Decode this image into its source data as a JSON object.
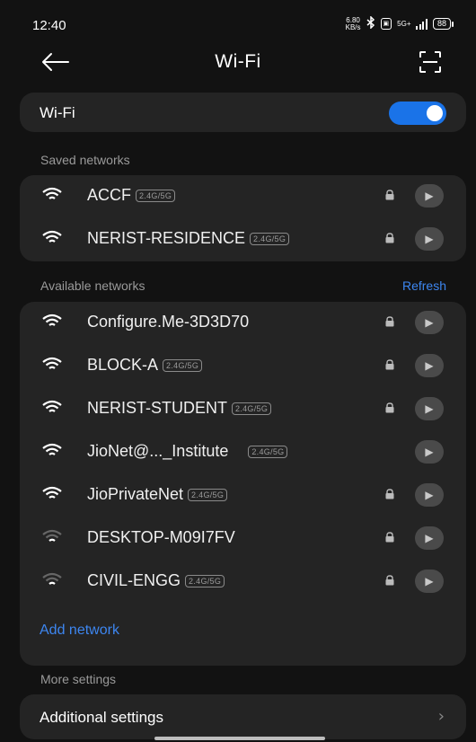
{
  "status_bar": {
    "time": "12:40",
    "net_speed_value": "6.80",
    "net_speed_unit": "KB/s",
    "sim_label": "",
    "network_type": "5G+",
    "battery": "88"
  },
  "app_bar": {
    "title": "Wi-Fi",
    "back_icon": "arrow-left",
    "scan_icon": "qr-scan"
  },
  "wifi_toggle": {
    "label": "Wi-Fi",
    "enabled": true
  },
  "saved_section": {
    "label": "Saved networks",
    "networks": [
      {
        "name": "ACCF",
        "badge": "2.4G/5G",
        "locked": true,
        "signal": "strong"
      },
      {
        "name": "NERIST-RESIDENCE",
        "badge": "2.4G/5G",
        "locked": true,
        "signal": "strong"
      }
    ]
  },
  "available_section": {
    "label": "Available networks",
    "refresh_label": "Refresh",
    "networks": [
      {
        "name": "Configure.Me-3D3D70",
        "badge": "",
        "locked": true,
        "signal": "strong"
      },
      {
        "name": "BLOCK-A",
        "badge": "2.4G/5G",
        "locked": true,
        "signal": "strong"
      },
      {
        "name": "NERIST-STUDENT",
        "badge": "2.4G/5G",
        "locked": true,
        "signal": "strong"
      },
      {
        "name": "JioNet@..._Institute",
        "badge": "2.4G/5G",
        "locked": false,
        "signal": "strong"
      },
      {
        "name": "JioPrivateNet",
        "badge": "2.4G/5G",
        "locked": true,
        "signal": "strong"
      },
      {
        "name": "DESKTOP-M09I7FV",
        "badge": "",
        "locked": true,
        "signal": "weak"
      },
      {
        "name": "CIVIL-ENGG",
        "badge": "2.4G/5G",
        "locked": true,
        "signal": "weak"
      }
    ],
    "add_network_label": "Add network"
  },
  "more_settings": {
    "label": "More settings",
    "additional_label": "Additional settings"
  },
  "colors": {
    "accent": "#1a73e8",
    "link": "#3d86f0",
    "card": "#242424",
    "background": "#121212"
  }
}
